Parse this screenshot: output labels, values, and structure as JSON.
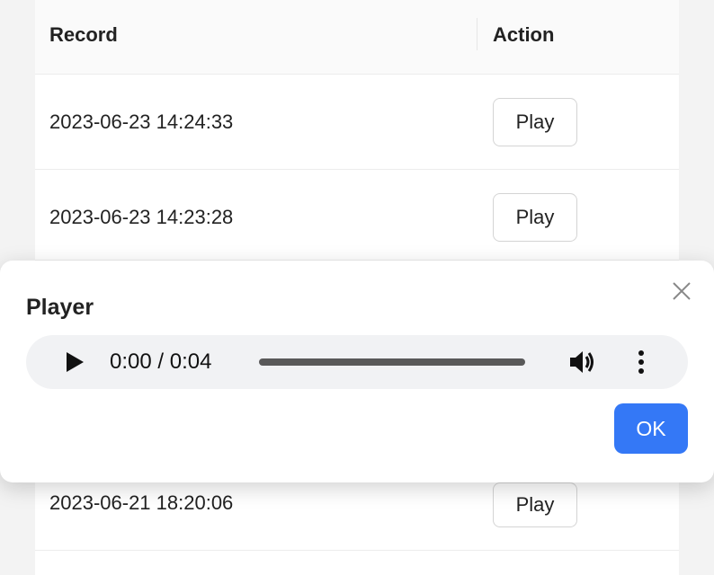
{
  "table": {
    "headers": [
      "Record",
      "Action"
    ],
    "rows": [
      {
        "record": "2023-06-23 14:24:33",
        "action": "Play"
      },
      {
        "record": "2023-06-23 14:23:28",
        "action": "Play"
      },
      {
        "record": "2023-06-21 18:20:06",
        "action": "Play"
      }
    ]
  },
  "modal": {
    "title": "Player",
    "close_icon": "close-icon",
    "ok_label": "OK",
    "audio": {
      "time": "0:00 / 0:04",
      "progress": 0,
      "play_icon": "play-icon",
      "volume_icon": "volume-icon",
      "more_icon": "more-vertical-icon"
    }
  },
  "colors": {
    "accent": "#3478f6"
  }
}
